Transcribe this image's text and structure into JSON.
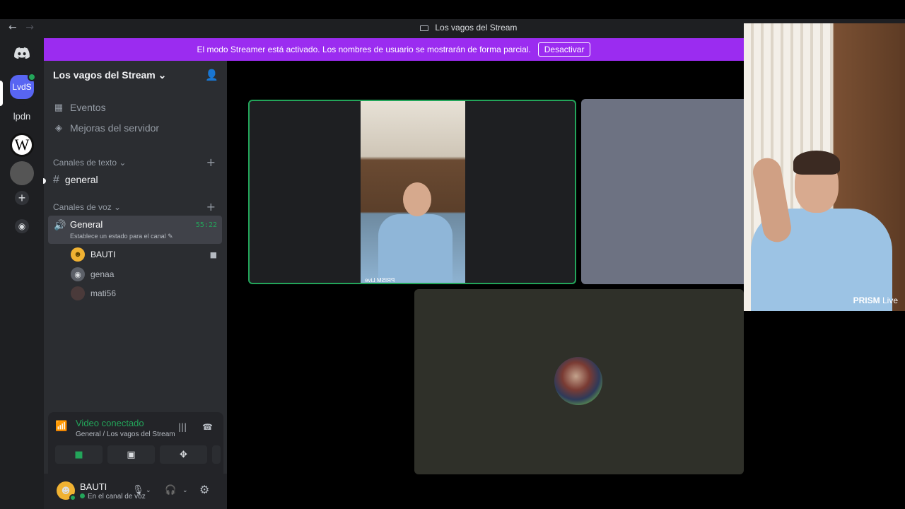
{
  "window": {
    "title": "Los vagos del Stream",
    "back_icon": "←",
    "forward_icon": "→"
  },
  "guilds": {
    "active_label": "LvdS",
    "lpdn_label": "lpdn",
    "wiki_label": "W"
  },
  "banner": {
    "text": "El modo Streamer está activado. Los nombres de usuario se mostrarán de forma parcial.",
    "button": "Desactivar"
  },
  "server": {
    "name": "Los vagos del Stream",
    "menu": [
      {
        "label": "Eventos"
      },
      {
        "label": "Mejoras del servidor"
      }
    ],
    "text_category": "Canales de texto",
    "text_channel": "general",
    "voice_category": "Canales de voz",
    "voice_channel": {
      "name": "General",
      "status": "Establece un estado para el canal",
      "timer": "55:22"
    },
    "voice_users": [
      {
        "name": "BAUTI"
      },
      {
        "name": "genaa"
      },
      {
        "name": "mati56"
      }
    ]
  },
  "voice_panel": {
    "title": "Video conectado",
    "subtitle": "General / Los vagos del Stream"
  },
  "user": {
    "name": "BAUTI",
    "status": "En el canal de voz"
  },
  "stage": {
    "tile1_watermark": "PRISM Live"
  },
  "camera_overlay": {
    "brand": "PRISM",
    "brand_suffix": "Live"
  },
  "colors": {
    "accent": "#5865f2",
    "banner": "#9b2cf0",
    "online": "#23a55a"
  }
}
